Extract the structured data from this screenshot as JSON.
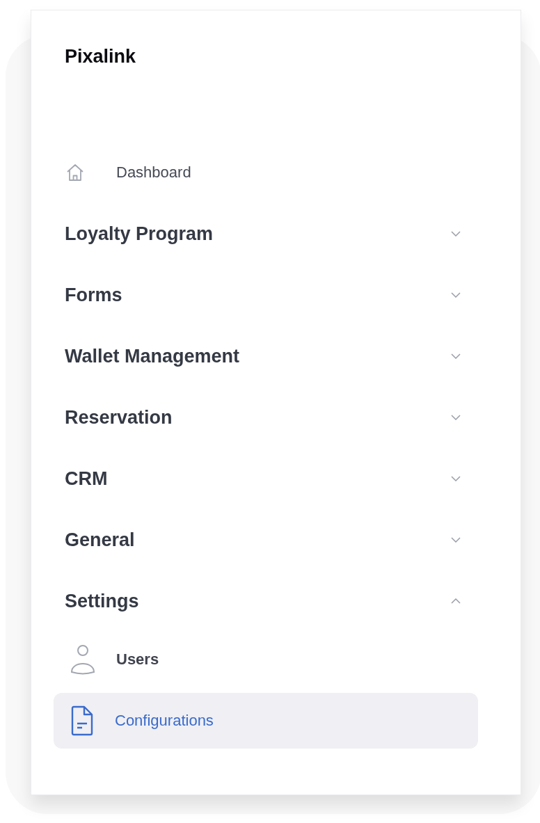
{
  "brand": "Pixalink",
  "nav": [
    {
      "kind": "link",
      "label": "Dashboard",
      "selected": false
    },
    {
      "kind": "section",
      "label": "Loyalty Program",
      "expanded": false
    },
    {
      "kind": "section",
      "label": "Forms",
      "expanded": false
    },
    {
      "kind": "section",
      "label": "Wallet Management",
      "expanded": false
    },
    {
      "kind": "section",
      "label": "Reservation",
      "expanded": false
    },
    {
      "kind": "section",
      "label": "CRM",
      "expanded": false
    },
    {
      "kind": "section",
      "label": "General",
      "expanded": false
    },
    {
      "kind": "section",
      "label": "Settings",
      "expanded": true,
      "children": [
        {
          "label": "Users",
          "selected": false
        },
        {
          "label": "Configurations",
          "selected": true
        }
      ]
    }
  ]
}
